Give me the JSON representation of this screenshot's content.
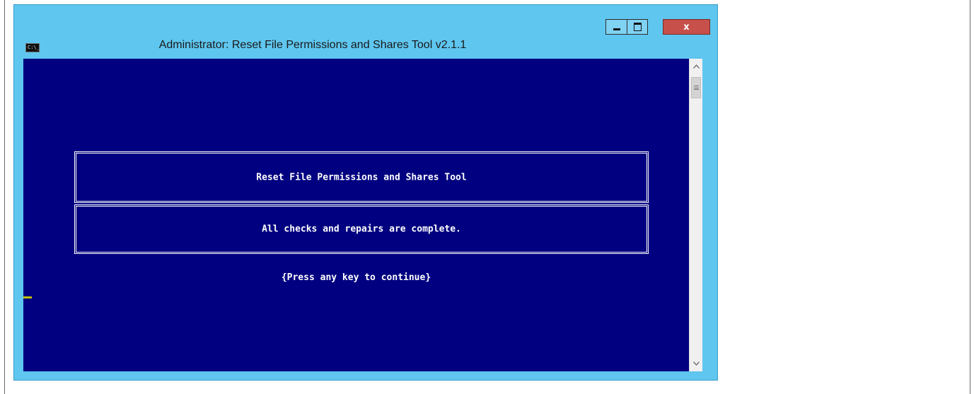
{
  "window": {
    "title": "Administrator:  Reset File Permissions and Shares Tool v2.1.1",
    "icon": "console-icon",
    "icon_glyph": "C:\\_",
    "controls": {
      "minimize": "minimize-icon",
      "maximize": "maximize-icon",
      "close": "close-icon",
      "close_label": "x"
    },
    "colors": {
      "frame": "#5fc6ef",
      "close_button": "#c7504a",
      "console_background": "#000080",
      "console_text": "#ffffff",
      "cursor": "#c0c000"
    }
  },
  "console": {
    "header_box_text": "Reset File Permissions and Shares Tool",
    "status_box_text": "All checks and repairs are complete.",
    "prompt_text": "{Press any key to continue}"
  },
  "scrollbar": {
    "up_icon": "chevron-up-icon",
    "down_icon": "chevron-down-icon"
  }
}
